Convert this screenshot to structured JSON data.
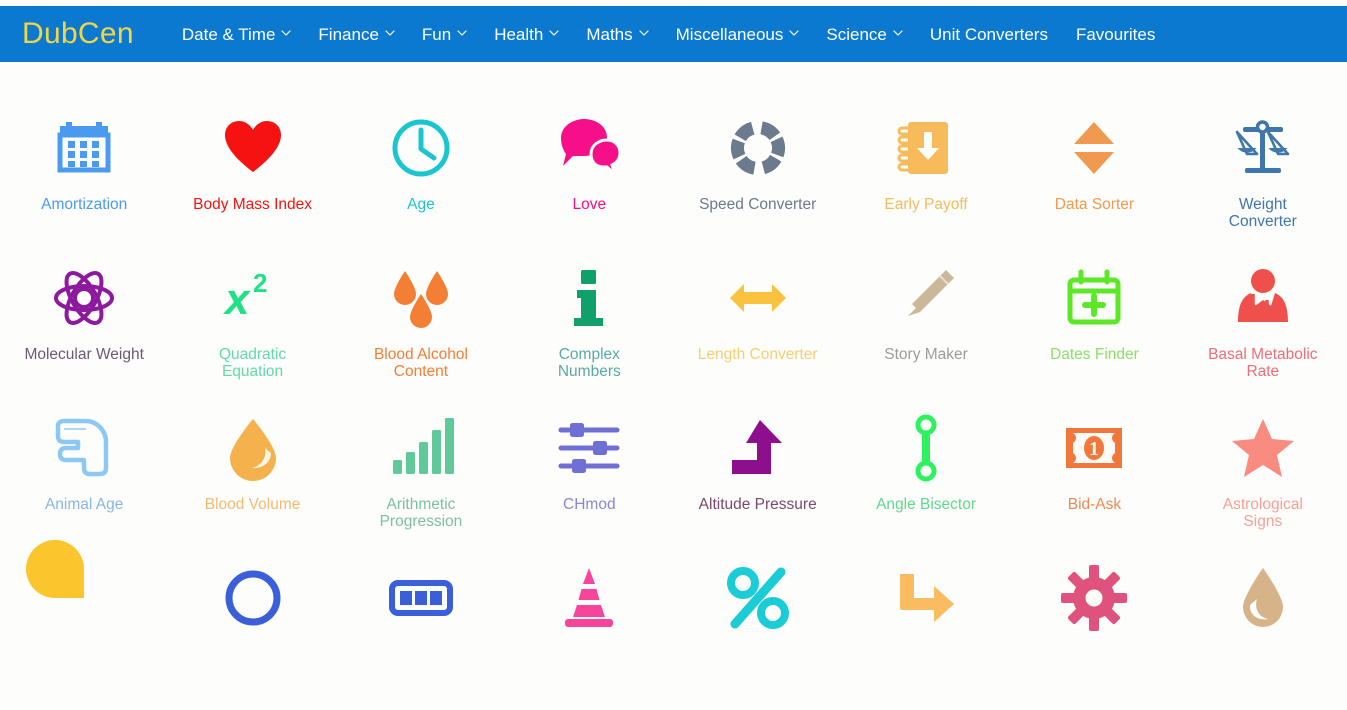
{
  "brand": "DubCen",
  "nav": {
    "items": [
      {
        "label": "Date & Time",
        "has_caret": true
      },
      {
        "label": "Finance",
        "has_caret": true
      },
      {
        "label": "Fun",
        "has_caret": true
      },
      {
        "label": "Health",
        "has_caret": true
      },
      {
        "label": "Maths",
        "has_caret": true
      },
      {
        "label": "Miscellaneous",
        "has_caret": true
      },
      {
        "label": "Science",
        "has_caret": true
      },
      {
        "label": "Unit Converters",
        "has_caret": false
      },
      {
        "label": "Favourites",
        "has_caret": false
      }
    ]
  },
  "colors": {
    "nav_bg": "#0b79d0",
    "brand": "#f2d544",
    "nav_text": "#ffffff",
    "page_bg": "#fdfdfb"
  },
  "tools": [
    {
      "label": "Amortization",
      "icon": "calendar-icon",
      "color": "#4a9bf0"
    },
    {
      "label": "Body Mass Index",
      "icon": "heart-icon",
      "color": "#f71212"
    },
    {
      "label": "Age",
      "icon": "clock-icon",
      "color": "#19c6d0"
    },
    {
      "label": "Love",
      "icon": "speech-bubbles-icon",
      "color": "#f70f8a"
    },
    {
      "label": "Speed Converter",
      "icon": "segmented-donut-icon",
      "color": "#6b7a8c"
    },
    {
      "label": "Early Payoff",
      "icon": "notebook-icon",
      "color": "#f7bb5c"
    },
    {
      "label": "Data Sorter",
      "icon": "sort-arrows-icon",
      "color": "#ef9a4e"
    },
    {
      "label": "Weight Converter",
      "icon": "balance-scale-icon",
      "color": "#3f76ab"
    },
    {
      "label": "Molecular Weight",
      "icon": "atom-icon",
      "color": "#8d1a9e",
      "label_color": "#6b5a74"
    },
    {
      "label": "Quadratic Equation",
      "icon": "x-squared-icon",
      "color": "#1fe286",
      "label_color": "#63d8b0"
    },
    {
      "label": "Blood Alcohol Content",
      "icon": "blood-drops-icon",
      "color": "#f57e35"
    },
    {
      "label": "Complex Numbers",
      "icon": "info-i-icon",
      "color": "#10a06a",
      "label_color": "#5aa8a8"
    },
    {
      "label": "Length Converter",
      "icon": "double-arrow-icon",
      "color": "#fbc23d",
      "label_color": "#f7cf72"
    },
    {
      "label": "Story Maker",
      "icon": "pencil-icon",
      "color": "#cbb79a",
      "label_color": "#9c9c9c"
    },
    {
      "label": "Dates Finder",
      "icon": "calendar-plus-icon",
      "color": "#5ce827",
      "label_color": "#8be06a"
    },
    {
      "label": "Basal Metabolic Rate",
      "icon": "doctor-icon",
      "color": "#f0504c",
      "label_color": "#ef6d7a"
    },
    {
      "label": "Animal Age",
      "icon": "paw-outline-icon",
      "color": "#8dc8f5",
      "label_color": "#89b7e0"
    },
    {
      "label": "Blood Volume",
      "icon": "water-drop-icon",
      "color": "#f5b14c",
      "label_color": "#f5b972"
    },
    {
      "label": "Arithmetic Progression",
      "icon": "bar-chart-icon",
      "color": "#5fc99a",
      "label_color": "#7cbfa8"
    },
    {
      "label": "CHmod",
      "icon": "sliders-icon",
      "color": "#6f6fd6",
      "label_color": "#8a85d6"
    },
    {
      "label": "Altitude Pressure",
      "icon": "up-arrow-icon",
      "color": "#8d0f8d",
      "label_color": "#7a4a6b"
    },
    {
      "label": "Angle Bisector",
      "icon": "angle-bisector-icon",
      "color": "#2df260",
      "label_color": "#5fd98a"
    },
    {
      "label": "Bid-Ask",
      "icon": "banknote-icon",
      "color": "#f2773a",
      "label_color": "#ef8a52"
    },
    {
      "label": "Astrological Signs",
      "icon": "star-icon",
      "color": "#f98b80",
      "label_color": "#f9a096"
    },
    {
      "label": "",
      "icon": "pie-chart-icon",
      "color": "#fbc62d"
    },
    {
      "label": "",
      "icon": "circle-ring-icon",
      "color": "#3a5fd9"
    },
    {
      "label": "",
      "icon": "battery-icon",
      "color": "#3a5fd9"
    },
    {
      "label": "",
      "icon": "traffic-cone-icon",
      "color": "#f7459a"
    },
    {
      "label": "",
      "icon": "percent-icon",
      "color": "#19ccd6"
    },
    {
      "label": "",
      "icon": "arrow-turn-icon",
      "color": "#fbbb60"
    },
    {
      "label": "",
      "icon": "gear-icon",
      "color": "#e0527e"
    },
    {
      "label": "",
      "icon": "drop-tan-icon",
      "color": "#d6b388"
    }
  ]
}
